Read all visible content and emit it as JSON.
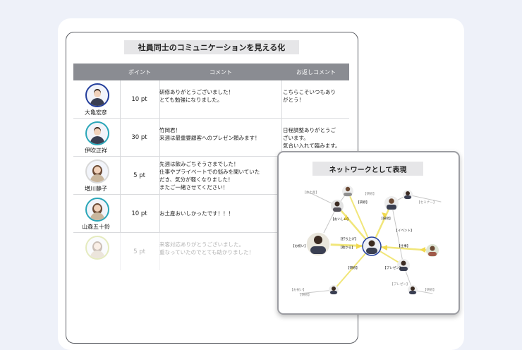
{
  "document": {
    "title": "社員同士のコミュニケーションを見える化",
    "columns": [
      "",
      "ポイント",
      "コメント",
      "お返しコメント"
    ],
    "rows": [
      {
        "name": "大亀宏彦",
        "points": "10 pt",
        "comment": "研修ありがとうございました！\nとても勉強になりました。",
        "reply": "こちらこそいつもあり\nがとう！"
      },
      {
        "name": "伊吹正祥",
        "points": "30 pt",
        "comment": "竹岡君！\n来週は最重要顧客へのプレゼン頼みます！",
        "reply": "日程調整ありがとうご\nざいます。\n気合い入れて臨みます。"
      },
      {
        "name": "増川静子",
        "points": "5 pt",
        "comment": "先週は飲みごちそうさまでした！\n仕事やプライベートでの悩みを聞いていた\nだき、気分が軽くなりました！\nまたご一緒させてください！",
        "reply": ""
      },
      {
        "name": "山森五十鈴",
        "points": "10 pt",
        "comment": "お土産おいしかったです！！！",
        "reply": ""
      },
      {
        "name": "",
        "points": "5 pt",
        "comment": "来客対応ありがとうございました。\n重なっていたのでとても助かりました！",
        "reply": ""
      }
    ]
  },
  "network": {
    "title": "ネットワークとして表現",
    "tags": {
      "t1": "【お土産】",
      "t2": "【研修】",
      "t3": "【研修】",
      "t4": "【研修】",
      "t5": "【お祝い】",
      "t6": "【おいしい】",
      "t7": "【打ち上げ】",
      "t8": "【プレゼン】",
      "t9": "【セミナー】",
      "t10": "【イベント】",
      "t11": "【助かる】",
      "t12": "【研修】",
      "t13": "【仕事】",
      "t14": "【研修】",
      "t15": "【プレゼン】",
      "t16": "【研修】",
      "t17": "【お祝い】"
    }
  }
}
